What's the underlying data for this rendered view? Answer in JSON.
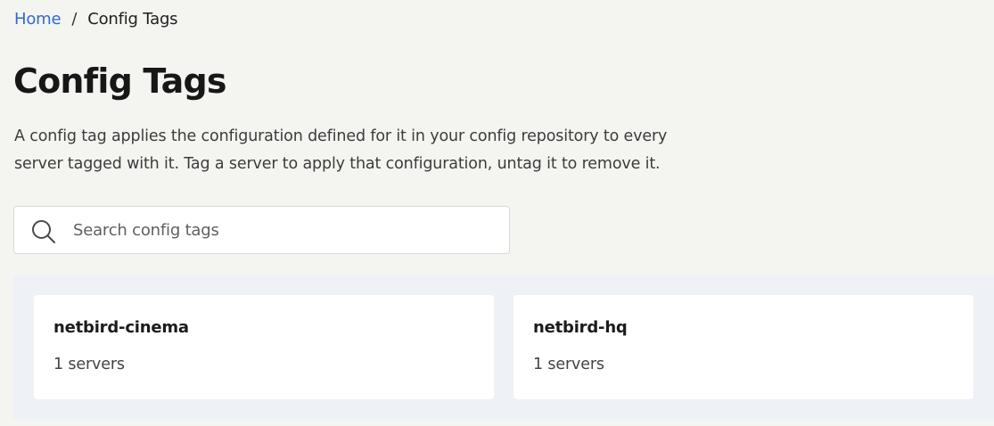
{
  "breadcrumb": {
    "home": "Home",
    "separator": "/",
    "current": "Config Tags"
  },
  "page": {
    "title": "Config Tags",
    "description": "A config tag applies the configuration defined for it in your config repository to every server tagged with it. Tag a server to apply that configuration, untag it to remove it."
  },
  "search": {
    "placeholder": "Search config tags",
    "value": "",
    "icon": "search-icon"
  },
  "tags": [
    {
      "name": "netbird-cinema",
      "count": "1 servers"
    },
    {
      "name": "netbird-hq",
      "count": "1 servers"
    }
  ],
  "colors": {
    "link": "#2f6ad0",
    "background": "#f4f4f0",
    "panel": "#eef2f7",
    "card": "#ffffff"
  }
}
